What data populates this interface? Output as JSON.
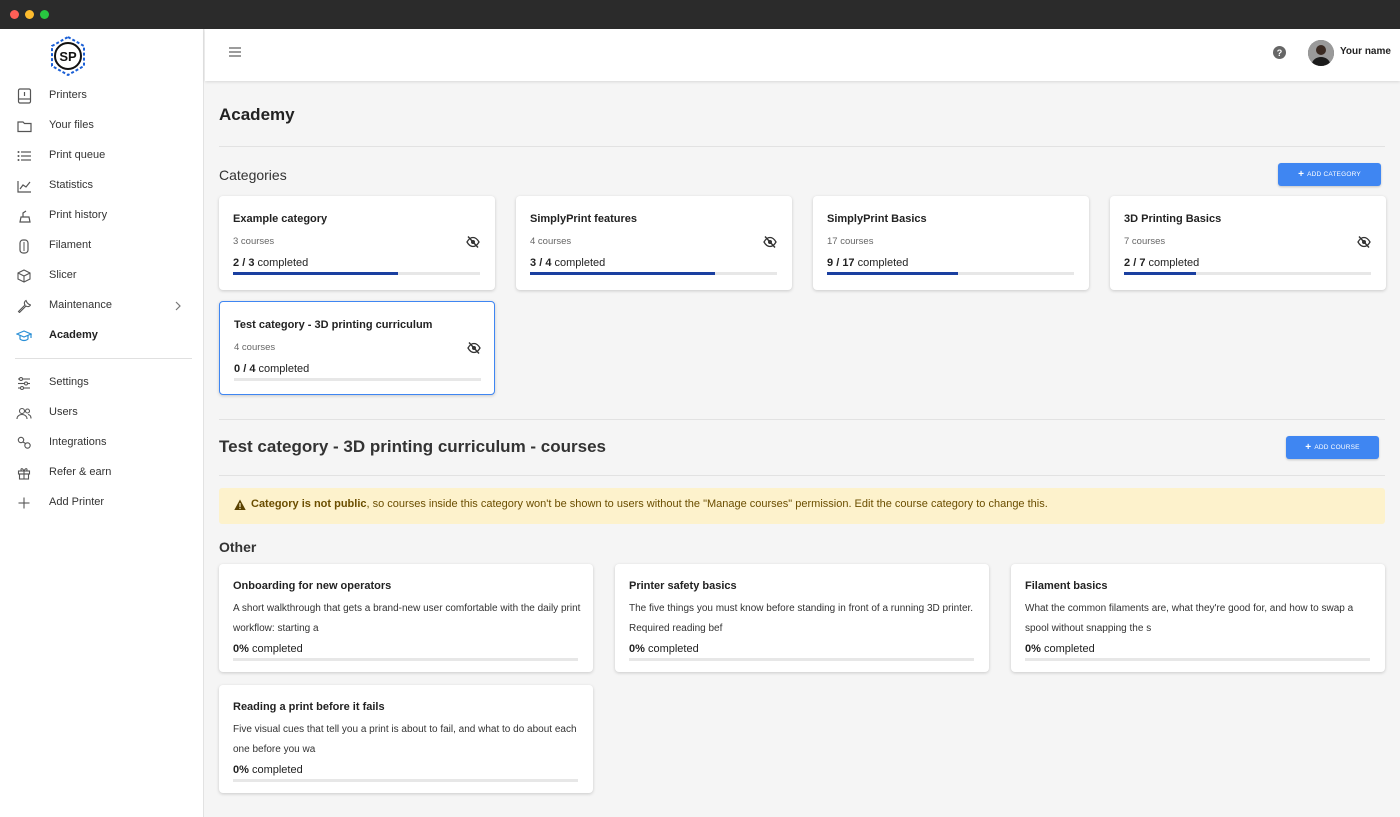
{
  "window": {
    "dots": [
      "#ff5f57",
      "#febc2e",
      "#28c840"
    ]
  },
  "brand": {
    "logo_text": "SP",
    "accent": "#1a3fa0"
  },
  "sidebar": {
    "items": [
      {
        "label": "Printers",
        "icon": "printer-icon"
      },
      {
        "label": "Your files",
        "icon": "folder-icon"
      },
      {
        "label": "Print queue",
        "icon": "list-icon"
      },
      {
        "label": "Statistics",
        "icon": "chart-line-icon"
      },
      {
        "label": "Print history",
        "icon": "history-icon"
      },
      {
        "label": "Filament",
        "icon": "filament-spool-icon"
      },
      {
        "label": "Slicer",
        "icon": "cube-icon"
      },
      {
        "label": "Maintenance",
        "icon": "wrench-icon"
      },
      {
        "label": "Academy",
        "icon": "graduation-cap-icon"
      },
      {
        "label": "Settings",
        "icon": "sliders-icon"
      },
      {
        "label": "Users",
        "icon": "users-icon"
      },
      {
        "label": "Integrations",
        "icon": "integrations-icon"
      },
      {
        "label": "Refer & earn",
        "icon": "gift-icon"
      },
      {
        "label": "Add Printer",
        "icon": "plus-icon"
      }
    ],
    "active": "Academy"
  },
  "topbar": {
    "user_name": "Your name",
    "help": "?"
  },
  "page": {
    "title": "Academy"
  },
  "categories": {
    "title": "Categories",
    "add_label": "ADD CATEGORY",
    "items": [
      {
        "title": "Example category",
        "courses": "3 courses",
        "done": "2",
        "total": "3",
        "completed_word": "completed",
        "progress": 0.67
      },
      {
        "title": "SimplyPrint features",
        "courses": "4 courses",
        "done": "3",
        "total": "4",
        "completed_word": "completed",
        "progress": 0.75
      },
      {
        "title": "SimplyPrint Basics",
        "courses": "17 courses",
        "done": "9",
        "total": "17",
        "completed_word": "completed",
        "progress": 0.53
      },
      {
        "title": "3D Printing Basics",
        "courses": "7 courses",
        "done": "2",
        "total": "7",
        "completed_word": "completed",
        "progress": 0.29
      },
      {
        "title": "Test category - 3D printing curriculum",
        "courses": "4 courses",
        "done": "0",
        "total": "4",
        "completed_word": "completed",
        "progress": 0
      }
    ]
  },
  "courses_section": {
    "title": "Test category - 3D printing curriculum - courses",
    "add_label": "ADD COURSE",
    "warning_bold": "Category is not public",
    "warning_rest": ", so courses inside this category won't be shown to users without the \"Manage courses\" permission. Edit the course category to change this.",
    "group": "Other",
    "items": [
      {
        "title": "Onboarding for new operators",
        "desc": "A short walkthrough that gets a brand-new user comfortable with the daily print workflow: starting a",
        "pct": "0%",
        "completed_word": "completed"
      },
      {
        "title": "Printer safety basics",
        "desc": "The five things you must know before standing in front of a running 3D printer. Required reading bef",
        "pct": "0%",
        "completed_word": "completed"
      },
      {
        "title": "Filament basics",
        "desc": "What the common filaments are, what they're good for, and how to swap a spool without snapping the s",
        "pct": "0%",
        "completed_word": "completed"
      },
      {
        "title": "Reading a print before it fails",
        "desc": "Five visual cues that tell you a print is about to fail, and what to do about each one before you wa",
        "pct": "0%",
        "completed_word": "completed"
      }
    ]
  }
}
